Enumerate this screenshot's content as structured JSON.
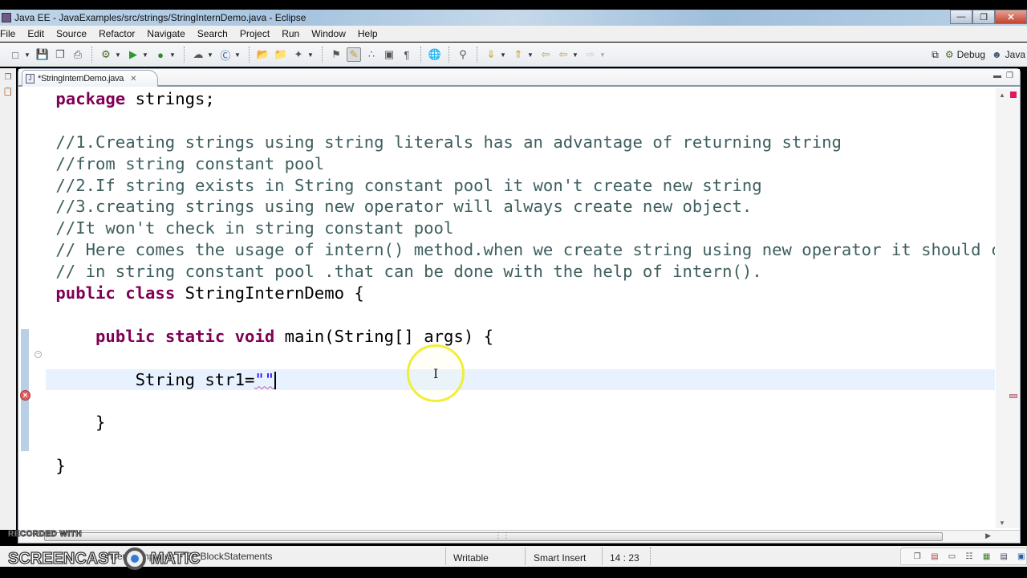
{
  "window": {
    "title": "Java EE - JavaExamples/src/strings/StringInternDemo.java - Eclipse",
    "controls": [
      "minimize",
      "restore",
      "close"
    ]
  },
  "menu": {
    "items": [
      "File",
      "Edit",
      "Source",
      "Refactor",
      "Navigate",
      "Search",
      "Project",
      "Run",
      "Window",
      "Help"
    ]
  },
  "toolbar": {
    "perspectives": [
      {
        "name": "open-perspective",
        "label": ""
      },
      {
        "name": "debug",
        "label": "Debug"
      },
      {
        "name": "java",
        "label": "Java"
      }
    ]
  },
  "editor": {
    "tab_label": "*StringInternDemo.java",
    "lines": [
      {
        "parts": [
          {
            "t": "package",
            "c": "kw"
          },
          {
            "t": " strings;",
            "c": ""
          }
        ]
      },
      {
        "parts": []
      },
      {
        "parts": [
          {
            "t": "//1.Creating strings using string literals has an advantage of returning string",
            "c": "cm"
          }
        ]
      },
      {
        "parts": [
          {
            "t": "//from string constant pool",
            "c": "cm"
          }
        ]
      },
      {
        "parts": [
          {
            "t": "//2.If string exists in String constant pool it won't create new string",
            "c": "cm"
          }
        ]
      },
      {
        "parts": [
          {
            "t": "//3.creating strings using new operator will always create new object.",
            "c": "cm"
          }
        ]
      },
      {
        "parts": [
          {
            "t": "//It won't check in string constant pool",
            "c": "cm"
          }
        ]
      },
      {
        "parts": [
          {
            "t": "// Here comes the usage of intern() method.when we create string using new operator it should c",
            "c": "cm"
          }
        ]
      },
      {
        "parts": [
          {
            "t": "// in string constant pool .that can be done with the help of intern().",
            "c": "cm"
          }
        ]
      },
      {
        "parts": [
          {
            "t": "public",
            "c": "kw"
          },
          {
            "t": " ",
            "c": ""
          },
          {
            "t": "class",
            "c": "kw"
          },
          {
            "t": " StringInternDemo {",
            "c": ""
          }
        ]
      },
      {
        "parts": []
      },
      {
        "parts": [
          {
            "t": "    ",
            "c": ""
          },
          {
            "t": "public",
            "c": "kw"
          },
          {
            "t": " ",
            "c": ""
          },
          {
            "t": "static",
            "c": "kw"
          },
          {
            "t": " ",
            "c": ""
          },
          {
            "t": "void",
            "c": "kw"
          },
          {
            "t": " main(String[] args) {",
            "c": ""
          }
        ]
      },
      {
        "parts": []
      },
      {
        "parts": [
          {
            "t": "        String str1=",
            "c": ""
          },
          {
            "t": "\"\"",
            "c": "str squiggle"
          }
        ],
        "current": true,
        "caret": true
      },
      {
        "parts": []
      },
      {
        "parts": [
          {
            "t": "    }",
            "c": ""
          }
        ]
      },
      {
        "parts": []
      },
      {
        "parts": [
          {
            "t": "}",
            "c": ""
          }
        ]
      }
    ]
  },
  "status": {
    "message": "Insert Templates > Ee BlockStatements",
    "writable": "Writable",
    "insert_mode": "Smart Insert",
    "position": "14 : 23"
  },
  "watermark": {
    "line1": "RECORDED WITH",
    "line2a": "SCREENCAST",
    "line2b": "MATIC"
  }
}
